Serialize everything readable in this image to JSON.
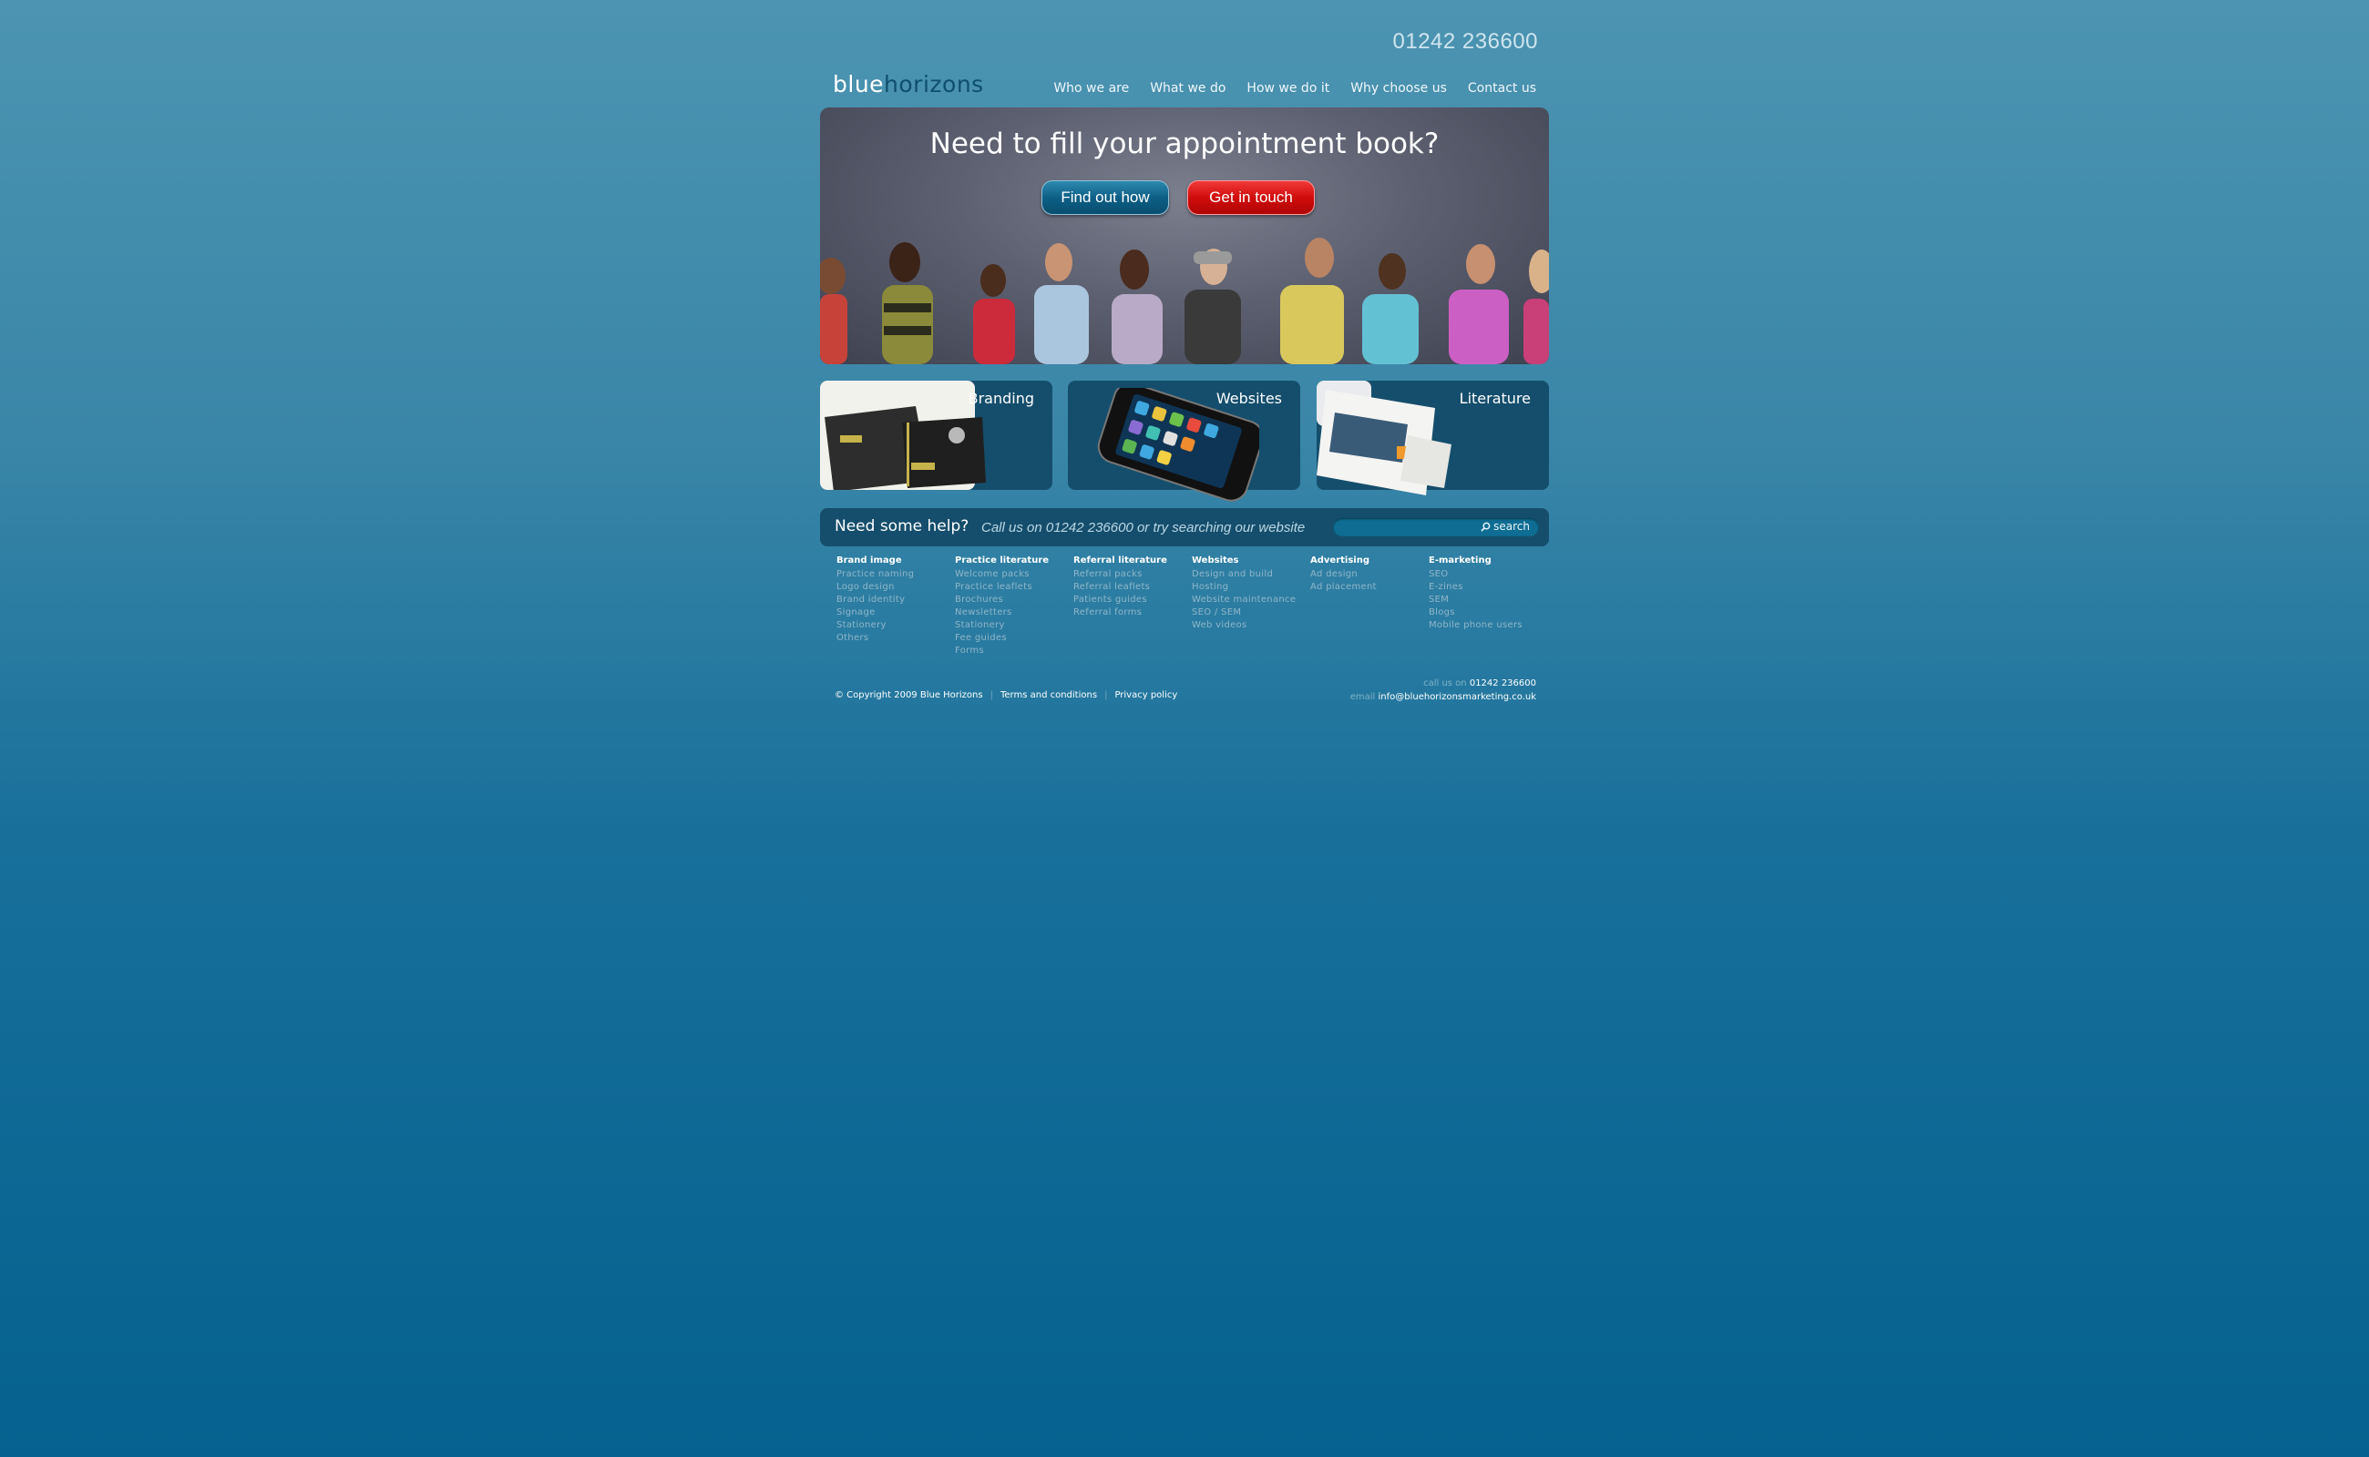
{
  "header": {
    "phone": "01242 236600",
    "logo_part1": "blue",
    "logo_part2": "horizons"
  },
  "nav": [
    "Who we are",
    "What we do",
    "How we do it",
    "Why choose us",
    "Contact us"
  ],
  "hero": {
    "title": "Need to fill your appointment book?",
    "button_primary": "Find out how",
    "button_secondary": "Get in touch"
  },
  "tiles": [
    {
      "title": "Branding"
    },
    {
      "title": "Websites"
    },
    {
      "title": "Literature"
    }
  ],
  "help": {
    "title": "Need some help?",
    "subtitle": "Call us on 01242 236600 or try searching our website",
    "search_value": "",
    "search_button": "search"
  },
  "sitemap": [
    {
      "heading": "Brand image",
      "links": [
        "Practice naming",
        "Logo design",
        "Brand identity",
        "Signage",
        "Stationery",
        "Others"
      ]
    },
    {
      "heading": "Practice literature",
      "links": [
        "Welcome packs",
        "Practice leaflets",
        "Brochures",
        "Newsletters",
        "Stationery",
        "Fee guides",
        "Forms"
      ]
    },
    {
      "heading": "Referral literature",
      "links": [
        "Referral packs",
        "Referral leaflets",
        "Patients guides",
        "Referral forms"
      ]
    },
    {
      "heading": "Websites",
      "links": [
        "Design and build",
        "Hosting",
        "Website maintenance",
        "SEO / SEM",
        "Web videos"
      ]
    },
    {
      "heading": "Advertising",
      "links": [
        "Ad design",
        "Ad placement"
      ]
    },
    {
      "heading": "E-marketing",
      "links": [
        "SEO",
        "E-zines",
        "SEM",
        "Blogs",
        "Mobile phone users"
      ]
    }
  ],
  "footer": {
    "copyright": "© Copyright 2009 Blue Horizons",
    "terms": "Terms and conditions",
    "privacy": "Privacy policy",
    "call_label": "call us on",
    "call_value": "01242 236600",
    "email_label": "email",
    "email_value": "info@bluehorizonsmarketing.co.uk"
  }
}
